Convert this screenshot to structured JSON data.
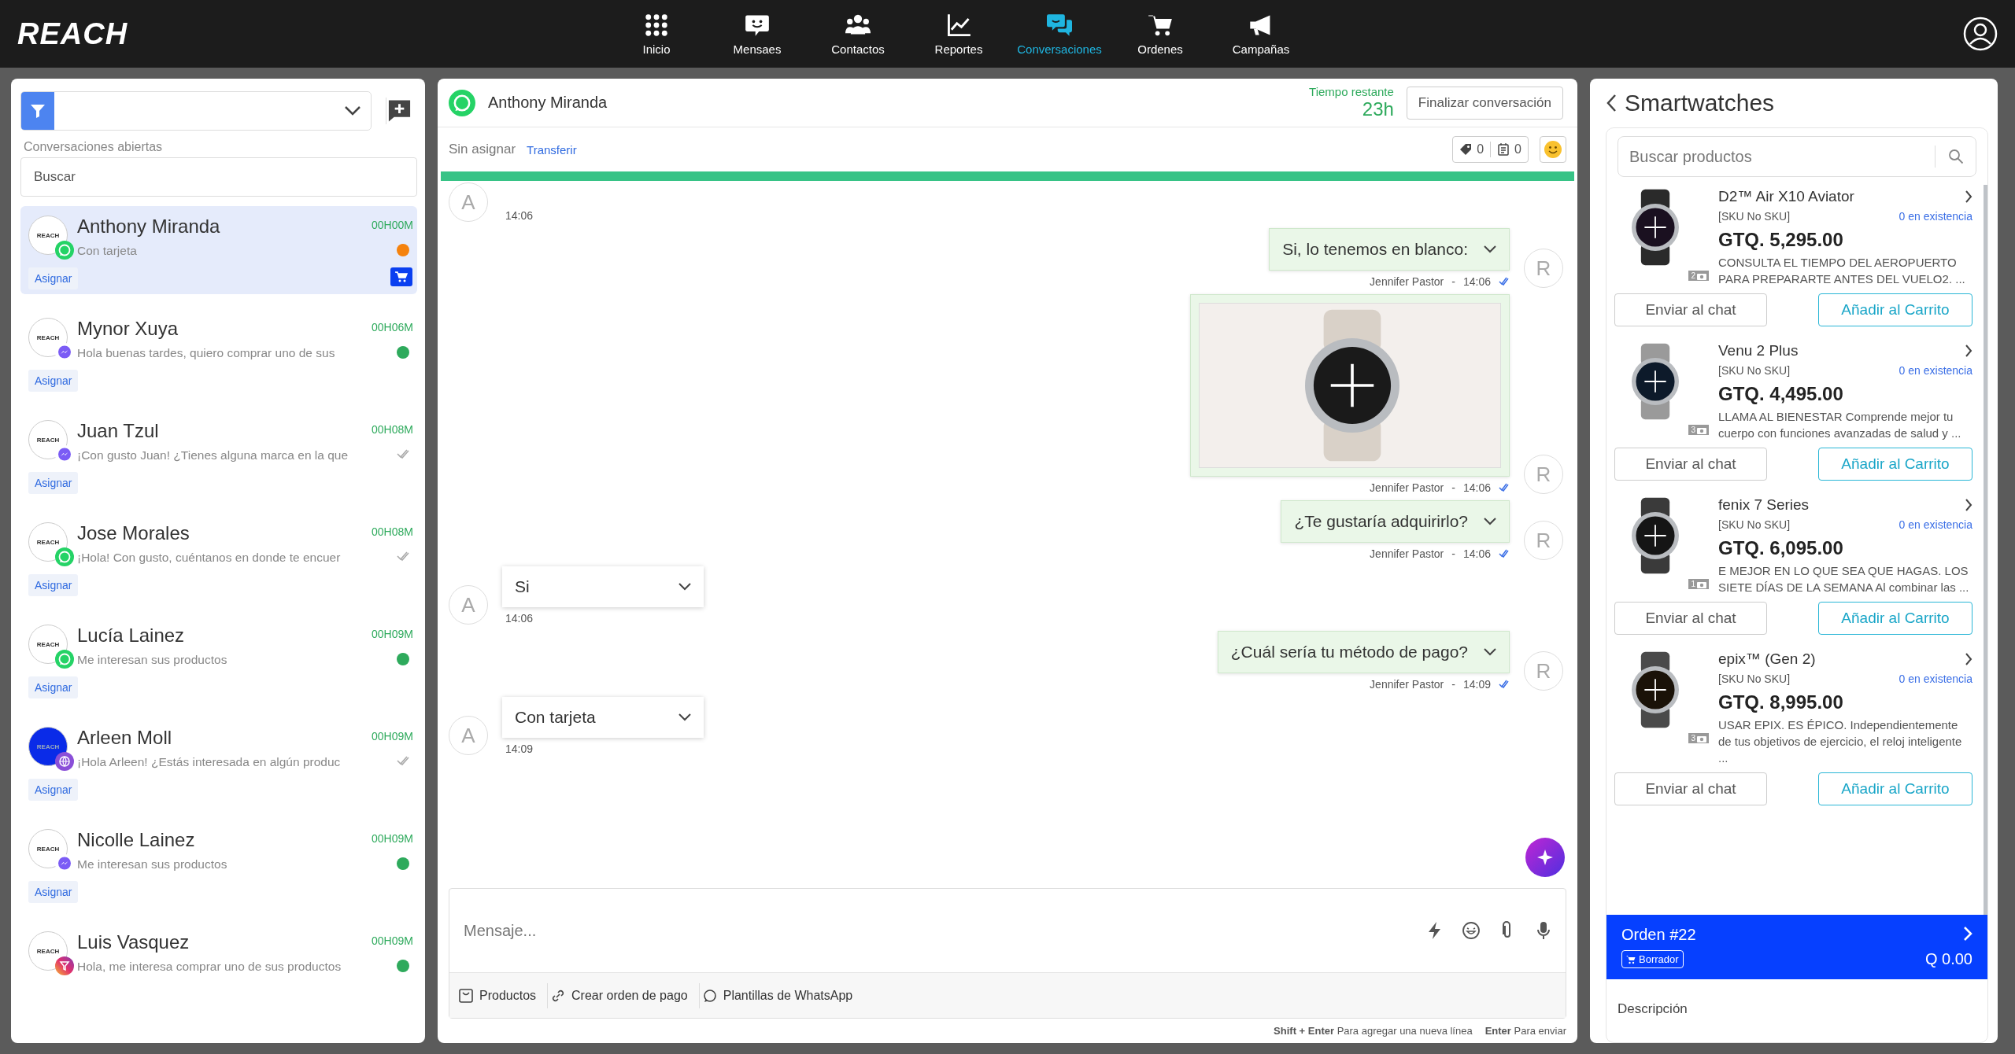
{
  "topbar": {
    "logo": "REACH",
    "nav": [
      {
        "label": "Inicio",
        "selected": false
      },
      {
        "label": "Mensaes",
        "selected": false
      },
      {
        "label": "Contactos",
        "selected": false
      },
      {
        "label": "Reportes",
        "selected": false
      },
      {
        "label": "Conversaciones",
        "selected": true
      },
      {
        "label": "Ordenes",
        "selected": false
      },
      {
        "label": "Campañas",
        "selected": false
      }
    ]
  },
  "sidebar": {
    "section_label": "Conversaciones abiertas",
    "search": {
      "placeholder": "Buscar"
    },
    "contacts": [
      {
        "name": "Anthony Miranda",
        "preview": "Con tarjeta",
        "time": "00H00M",
        "channel": {
          "kind": "whatsapp"
        },
        "avatar": {
          "label": "REACH",
          "color": "#ffffff"
        },
        "status": {
          "kind": "dot",
          "color": "#f5820d"
        },
        "assign": "Asignar",
        "cart": true,
        "selected": true
      },
      {
        "name": "Mynor Xuya",
        "preview": "Hola buenas tardes, quiero comprar uno de sus",
        "time": "00H06M",
        "channel": {
          "kind": "messenger"
        },
        "avatar": {
          "label": "REACH",
          "color": "#ffffff"
        },
        "status": {
          "kind": "dot",
          "color": "#2eaa5c"
        },
        "assign": "Asignar",
        "cart": false,
        "selected": false
      },
      {
        "name": "Juan Tzul",
        "preview": "¡Con gusto Juan! ¿Tienes alguna marca en la que",
        "time": "00H08M",
        "channel": {
          "kind": "messenger"
        },
        "avatar": {
          "label": "REACH",
          "color": "#ffffff"
        },
        "status": {
          "kind": "read"
        },
        "assign": "Asignar",
        "cart": false,
        "selected": false
      },
      {
        "name": "Jose Morales",
        "preview": "¡Hola! Con gusto, cuéntanos en donde te encuer",
        "time": "00H08M",
        "channel": {
          "kind": "whatsapp"
        },
        "avatar": {
          "label": "REACH",
          "color": "#ffffff"
        },
        "status": {
          "kind": "read"
        },
        "assign": "Asignar",
        "cart": false,
        "selected": false
      },
      {
        "name": "Lucía Lainez",
        "preview": "Me interesan sus productos",
        "time": "00H09M",
        "channel": {
          "kind": "whatsapp"
        },
        "avatar": {
          "label": "REACH",
          "color": "#ffffff"
        },
        "status": {
          "kind": "dot",
          "color": "#2eaa5c"
        },
        "assign": "Asignar",
        "cart": false,
        "selected": false
      },
      {
        "name": "Arleen Moll",
        "preview": "¡Hola Arleen! ¿Estás interesada en algún produc",
        "time": "00H09M",
        "channel": {
          "kind": "webchat"
        },
        "avatar": {
          "label": "REACH",
          "color": "#0a2be8"
        },
        "status": {
          "kind": "read"
        },
        "assign": "Asignar",
        "cart": false,
        "selected": false
      },
      {
        "name": "Nicolle Lainez",
        "preview": "Me interesan sus productos",
        "time": "00H09M",
        "channel": {
          "kind": "messenger"
        },
        "avatar": {
          "label": "REACH",
          "color": "#ffffff"
        },
        "status": {
          "kind": "dot",
          "color": "#2eaa5c"
        },
        "assign": "Asignar",
        "cart": false,
        "selected": false
      },
      {
        "name": "Luis Vasquez",
        "preview": "Hola, me interesa comprar uno de sus productos",
        "time": "00H09M",
        "channel": {
          "kind": "instagram"
        },
        "avatar": {
          "label": "REACH",
          "color": "#ffffff"
        },
        "status": {
          "kind": "dot",
          "color": "#2eaa5c"
        },
        "cart": false,
        "selected": false
      }
    ]
  },
  "chat": {
    "contact_name": "Anthony Miranda",
    "channel": {
      "kind": "whatsapp"
    },
    "remaining_label": "Tiempo restante",
    "remaining_value": "23h",
    "end_button": "Finalizar conversación",
    "assignee": "Sin asignar",
    "transfer_link": "Transferir",
    "tag_count": "0",
    "note_count": "0",
    "time_bar": {
      "level": 1
    },
    "messages": [
      {
        "kind": "stub",
        "avatar": "A",
        "time": "14:06"
      },
      {
        "kind": "out",
        "text": "Si, lo tenemos en blanco:",
        "author": "Jennifer Pastor",
        "separator": "-",
        "time": "14:06",
        "avatar": "R"
      },
      {
        "kind": "image",
        "author": "Jennifer Pastor",
        "separator": "-",
        "time": "14:06",
        "avatar": "R"
      },
      {
        "kind": "out",
        "text": "¿Te gustaría adquirirlo?",
        "author": "Jennifer Pastor",
        "separator": "-",
        "time": "14:06",
        "avatar": "R"
      },
      {
        "kind": "in",
        "text": "Si",
        "time": "14:06",
        "avatar": "A"
      },
      {
        "kind": "out",
        "text": "¿Cuál sería tu método de pago?",
        "author": "Jennifer Pastor",
        "separator": "-",
        "time": "14:09",
        "avatar": "R"
      },
      {
        "kind": "in",
        "text": "Con tarjeta",
        "time": "14:09",
        "avatar": "A"
      }
    ],
    "composer": {
      "placeholder": "Mensaje...",
      "tools": [
        "Productos",
        "Crear orden de pago",
        "Plantillas de WhatsApp"
      ],
      "hints": [
        "**Shift + Enter** Para agregar una nueva línea",
        "**Enter** Para enviar"
      ]
    }
  },
  "products_panel": {
    "title": "Smartwatches",
    "search": {
      "placeholder": "Buscar productos"
    },
    "products": [
      {
        "name": "D2™ Air X10 Aviator",
        "sku": "[SKU No SKU]",
        "stock": "0 en existencia",
        "price": "GTQ. 5,295.00",
        "description": "CONSULTA EL TIEMPO DEL AEROPUERTO PARA PREPARARTE ANTES DEL VUELO2. ...",
        "photos": "2",
        "send": "Enviar al chat",
        "add": "Añadir al Carrito"
      },
      {
        "name": "Venu 2 Plus",
        "sku": "[SKU No SKU]",
        "stock": "0 en existencia",
        "price": "GTQ. 4,495.00",
        "description": "LLAMA AL BIENESTAR Comprende mejor tu cuerpo con funciones avanzadas de salud y ...",
        "photos": "3",
        "send": "Enviar al chat",
        "add": "Añadir al Carrito"
      },
      {
        "name": "fenix 7 Series",
        "sku": "[SKU No SKU]",
        "stock": "0 en existencia",
        "price": "GTQ. 6,095.00",
        "description": "E MEJOR EN LO QUE SEA QUE HAGAS. LOS SIETE DÍAS DE LA SEMANA Al combinar las ...",
        "photos": "1",
        "send": "Enviar al chat",
        "add": "Añadir al Carrito"
      },
      {
        "name": "epix™ (Gen 2)",
        "sku": "[SKU No SKU]",
        "stock": "0 en existencia",
        "price": "GTQ. 8,995.00",
        "description": "USAR EPIX. ES ÉPICO. Independientemente de tus objetivos de ejercicio, el reloj inteligente ...",
        "photos": "3",
        "send": "Enviar al chat",
        "add": "Añadir al Carrito"
      }
    ],
    "order": {
      "title": "Orden #22",
      "status": "Borrador",
      "total": "Q 0.00"
    },
    "description_label": "Descripción"
  }
}
